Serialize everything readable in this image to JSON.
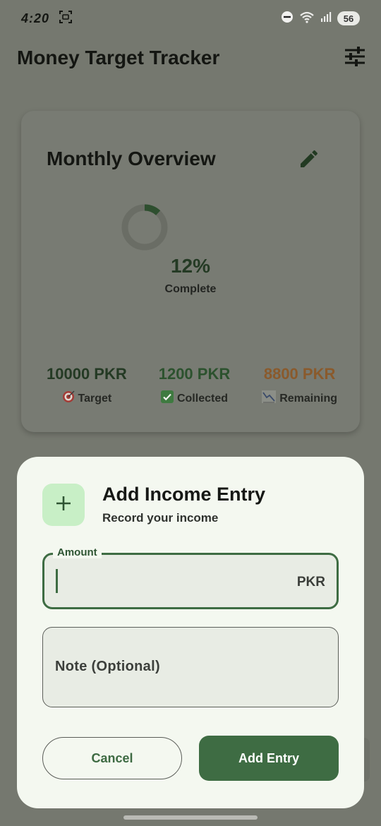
{
  "status_bar": {
    "time": "4:20",
    "battery": "56"
  },
  "app": {
    "title": "Money Target Tracker"
  },
  "overview": {
    "title": "Monthly Overview",
    "progress_percent": 12,
    "percent_text": "12%",
    "complete_label": "Complete",
    "stats": [
      {
        "value": "10000 PKR",
        "label": "Target",
        "icon": "target-icon",
        "color": "#243a24"
      },
      {
        "value": "1200 PKR",
        "label": "Collected",
        "icon": "check-box-icon",
        "color": "#2c522e"
      },
      {
        "value": "8800 PKR",
        "label": "Remaining",
        "icon": "trend-down-icon",
        "color": "#8a5a2c"
      }
    ]
  },
  "sheet": {
    "title": "Add Income Entry",
    "subtitle": "Record your income",
    "amount_label": "Amount",
    "amount_value": "",
    "amount_suffix": "PKR",
    "note_placeholder": "Note (Optional)",
    "cancel_label": "Cancel",
    "add_label": "Add Entry"
  },
  "colors": {
    "accent": "#3e6c43",
    "accent_container": "#c8efc6",
    "scrim_background": "#75786f",
    "sheet_background": "#f4f8f0"
  }
}
